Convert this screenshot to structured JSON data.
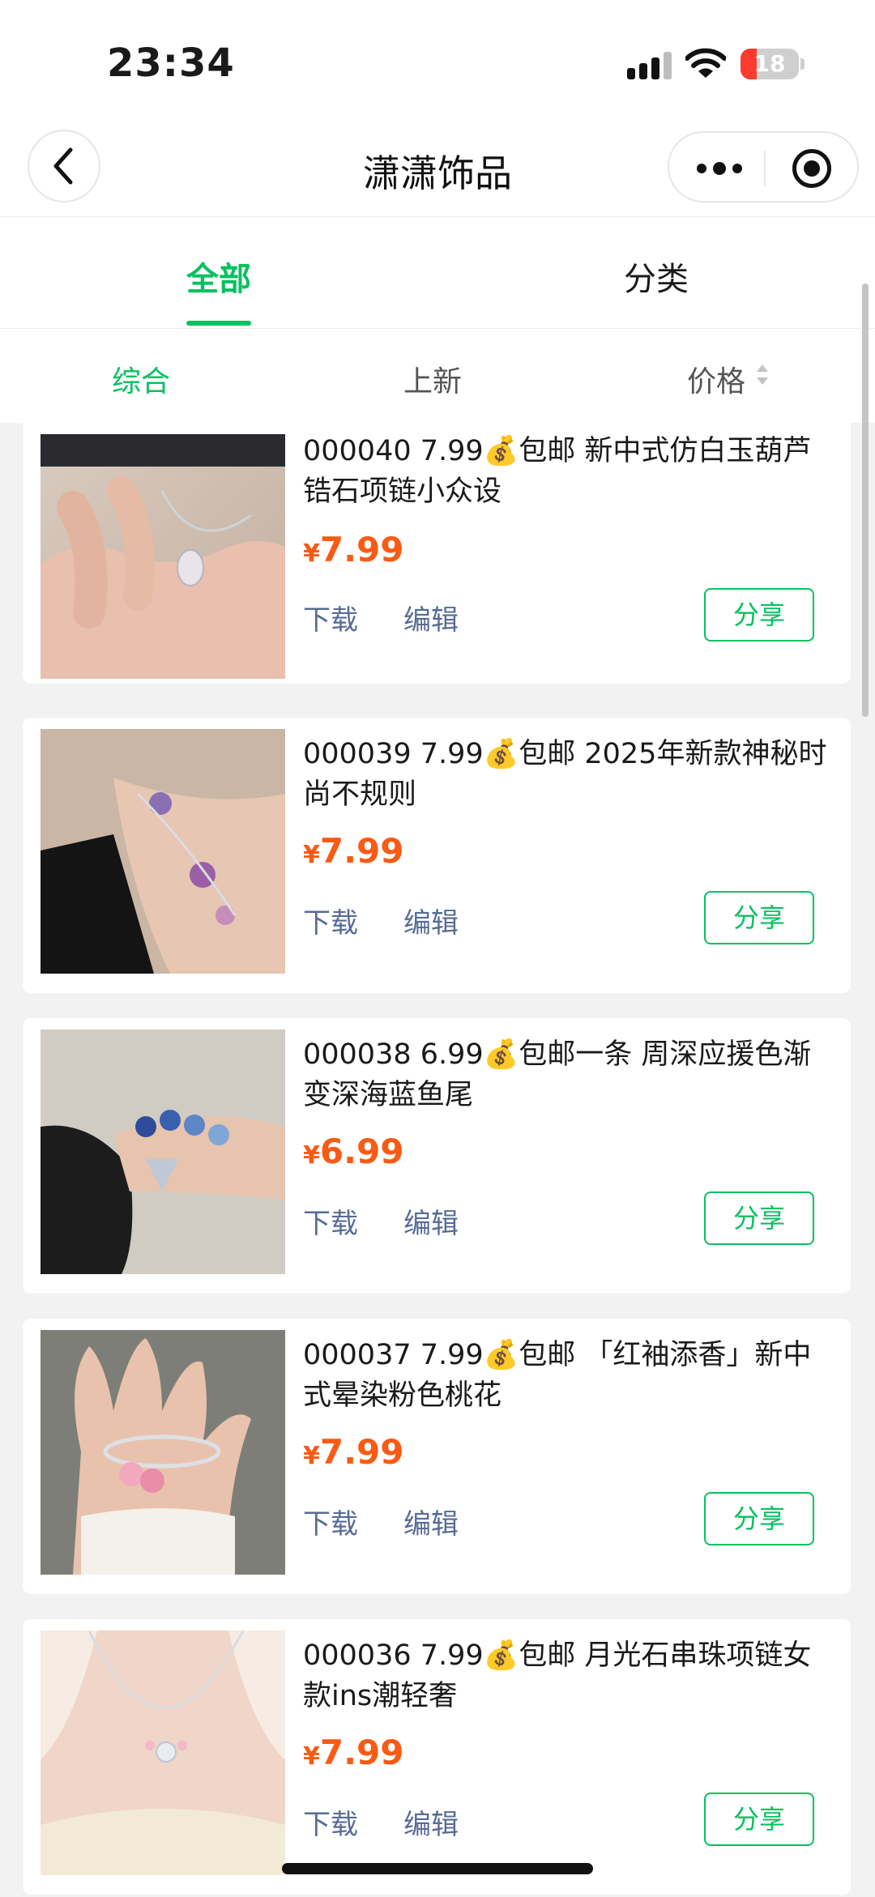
{
  "status_bar": {
    "time": "23:34",
    "battery_level": "18",
    "icons": [
      "signal-icon",
      "wifi-icon",
      "battery-icon"
    ]
  },
  "nav": {
    "title": "潇潇饰品",
    "icons": [
      "back-icon",
      "more-icon",
      "target-icon"
    ]
  },
  "tabs": [
    {
      "label": "全部",
      "active": true
    },
    {
      "label": "分类",
      "active": false
    }
  ],
  "sort": [
    {
      "label": "综合",
      "active": true
    },
    {
      "label": "上新"
    },
    {
      "label": "价格"
    }
  ],
  "colors": {
    "accent": "#07c160",
    "price": "#fa5a14",
    "action": "#576b95"
  },
  "products": [
    {
      "title": "000040 7.99💰包邮 新中式仿白玉葫芦锆石项链小众设",
      "currency": "¥",
      "price": "7.99",
      "download": "下载",
      "edit": "编辑",
      "share": "分享"
    },
    {
      "title": "000039 7.99💰包邮 2025年新款神秘时尚不规则",
      "currency": "¥",
      "price": "7.99",
      "download": "下载",
      "edit": "编辑",
      "share": "分享"
    },
    {
      "title": "000038 6.99💰包邮一条 周深应援色渐变深海蓝鱼尾",
      "currency": "¥",
      "price": "6.99",
      "download": "下载",
      "edit": "编辑",
      "share": "分享"
    },
    {
      "title": "000037 7.99💰包邮 「红袖添香」新中式晕染粉色桃花",
      "currency": "¥",
      "price": "7.99",
      "download": "下载",
      "edit": "编辑",
      "share": "分享"
    },
    {
      "title": "000036 7.99💰包邮 月光石串珠项链女款ins潮轻奢",
      "currency": "¥",
      "price": "7.99",
      "download": "下载",
      "edit": "编辑",
      "share": "分享"
    }
  ]
}
